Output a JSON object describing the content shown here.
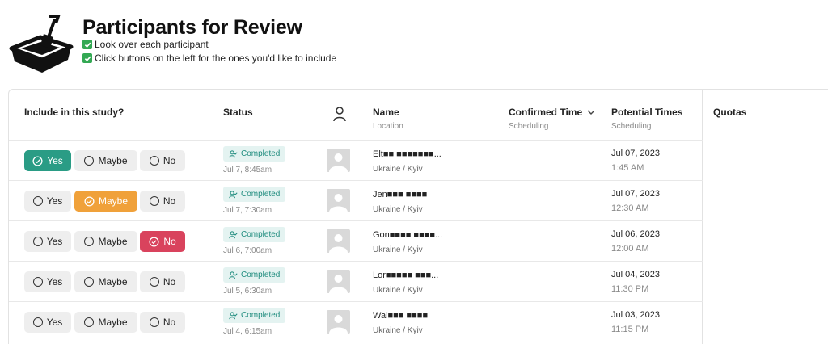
{
  "header": {
    "title": "Participants for Review",
    "instructions": [
      "Look over each participant",
      "Click buttons on the left for the ones you'd like to include"
    ]
  },
  "table": {
    "columns": {
      "include": "Include in this study?",
      "status": "Status",
      "name": "Name",
      "name_sub": "Location",
      "confirmed": "Confirmed Time",
      "confirmed_sub": "Scheduling",
      "potential": "Potential Times",
      "potential_sub": "Scheduling",
      "quotas": "Quotas"
    },
    "option_labels": {
      "yes": "Yes",
      "maybe": "Maybe",
      "no": "No"
    },
    "rows": [
      {
        "selected": "yes",
        "status": "Completed",
        "status_time": "Jul 7, 8:45am",
        "name": "Elt■■ ■■■■■■■...",
        "location": "Ukraine / Kyiv",
        "date": "Jul 07, 2023",
        "time": "1:45 AM"
      },
      {
        "selected": "maybe",
        "status": "Completed",
        "status_time": "Jul 7, 7:30am",
        "name": "Jen■■■ ■■■■",
        "location": "Ukraine / Kyiv",
        "date": "Jul 07, 2023",
        "time": "12:30 AM"
      },
      {
        "selected": "no",
        "status": "Completed",
        "status_time": "Jul 6, 7:00am",
        "name": "Gon■■■■ ■■■■...",
        "location": "Ukraine / Kyiv",
        "date": "Jul 06, 2023",
        "time": "12:00 AM"
      },
      {
        "selected": "",
        "status": "Completed",
        "status_time": "Jul 5, 6:30am",
        "name": "Lor■■■■■ ■■■...",
        "location": "Ukraine / Kyiv",
        "date": "Jul 04, 2023",
        "time": "11:30 PM"
      },
      {
        "selected": "",
        "status": "Completed",
        "status_time": "Jul 4, 6:15am",
        "name": "Wal■■■ ■■■■",
        "location": "Ukraine / Kyiv",
        "date": "Jul 03, 2023",
        "time": "11:15 PM"
      }
    ]
  },
  "colors": {
    "yes": "#2a9c85",
    "maybe": "#f0a13a",
    "no": "#d9435d",
    "status_text": "#1f8c7e",
    "status_bg": "#e4f3f1",
    "checkmark_box": "#33a853"
  },
  "icons": {
    "logo": "sandbox-shovel-icon",
    "instruction": "checkmark-box-icon",
    "person_header": "person-icon",
    "status": "user-check-icon",
    "sort": "chevron-down-icon",
    "avatar": "avatar-placeholder-icon"
  }
}
